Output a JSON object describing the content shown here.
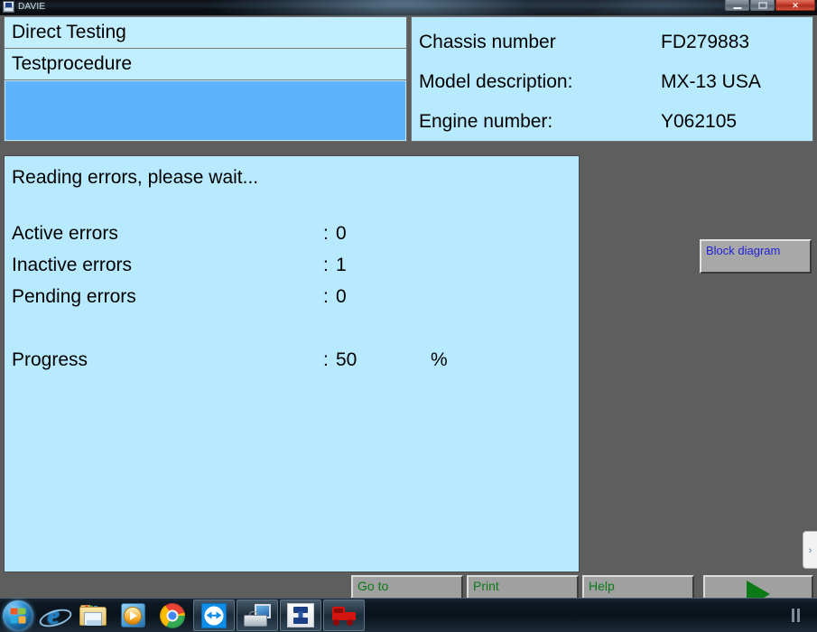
{
  "window": {
    "title": "DAVIE",
    "icon": "app-icon",
    "controls": {
      "minimize": "–",
      "maximize": "☐",
      "close": "✕"
    }
  },
  "header": {
    "left_rows": [
      {
        "label": "Direct Testing"
      },
      {
        "label": "Testprocedure"
      },
      {
        "label": ""
      }
    ],
    "vehicle_info": [
      {
        "label": "Chassis number",
        "value": "FD279883"
      },
      {
        "label": "Model description:",
        "value": "MX-13 USA"
      },
      {
        "label": "Engine number:",
        "value": "Y062105"
      }
    ]
  },
  "main": {
    "status_message": "Reading errors, please wait...",
    "colon": ":",
    "rows": [
      {
        "label": "Active errors",
        "value": "0",
        "unit": ""
      },
      {
        "label": "Inactive errors",
        "value": "1",
        "unit": ""
      },
      {
        "label": "Pending errors",
        "value": "0",
        "unit": ""
      }
    ],
    "progress": {
      "label": "Progress",
      "value": "50",
      "unit": "%"
    }
  },
  "side_panel": {
    "block_diagram_label": "Block diagram",
    "slide_tab_glyph": "›"
  },
  "toolbar": {
    "goto_label": "Go to",
    "print_label": "Print",
    "help_label": "Help",
    "next_label": ""
  },
  "taskbar": {
    "items": [
      {
        "name": "start-orb",
        "title": "Start"
      },
      {
        "name": "internet-explorer-icon",
        "title": "Internet Explorer"
      },
      {
        "name": "file-explorer-icon",
        "title": "Windows Explorer"
      },
      {
        "name": "media-player-icon",
        "title": "Windows Media Player"
      },
      {
        "name": "google-chrome-icon",
        "title": "Google Chrome"
      },
      {
        "name": "teamviewer-icon",
        "title": "TeamViewer"
      },
      {
        "name": "diagnostic-kit-icon",
        "title": "Diagnostic Kit"
      },
      {
        "name": "interface-tool-icon",
        "title": "Interface Tool"
      },
      {
        "name": "daf-truck-icon",
        "title": "DAVIE"
      }
    ]
  },
  "colors": {
    "panel_background": "#b7eaff",
    "header_row_background": "#c2efff",
    "header_selected_row": "#5fb3fc",
    "app_background": "#5e5e5e",
    "button_face": "#a0a0a0",
    "button_text_green": "#0a7a18",
    "block_diagram_text": "#1f1fd8",
    "play_arrow_green": "#0d7a18"
  }
}
